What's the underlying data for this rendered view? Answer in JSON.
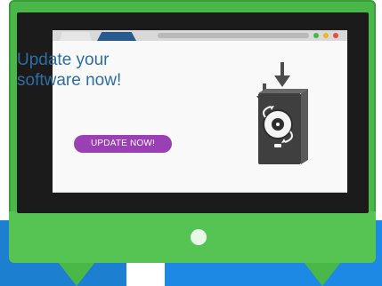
{
  "browser": {
    "dots": [
      {
        "color": "#45b84a"
      },
      {
        "color": "#f2b51a"
      },
      {
        "color": "#e84c3d"
      }
    ]
  },
  "hero": {
    "headline_line1": "Update your",
    "headline_line2": "software now!",
    "button_label": "UPDATE NOW!"
  },
  "colors": {
    "monitor_green": "#4ab849",
    "screen_black": "#1b1b1b",
    "headline_blue": "#2c6ea3",
    "button_purple": "#9b3fb4",
    "background_blue": "#1e88e5"
  },
  "icons": {
    "download_arrows": "download-arrow-icon",
    "software_box": "software-box-icon",
    "mascot": "mascot-face-icon"
  }
}
